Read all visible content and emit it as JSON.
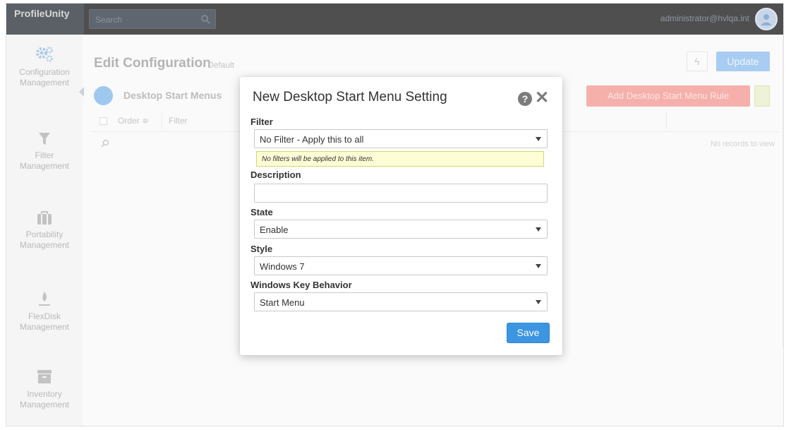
{
  "app": {
    "brand": "ProfileUnity",
    "search_placeholder": "Search",
    "user": "administrator@hvlqa.int"
  },
  "sidebar": {
    "items": [
      {
        "label_line1": "Configuration",
        "label_line2": "Management",
        "icon": "gears-icon"
      },
      {
        "label_line1": "Filter",
        "label_line2": "Management",
        "icon": "funnel-icon"
      },
      {
        "label_line1": "Portability",
        "label_line2": "Management",
        "icon": "briefcase-icon"
      },
      {
        "label_line1": "FlexDisk",
        "label_line2": "Management",
        "icon": "flame-icon"
      },
      {
        "label_line1": "Inventory",
        "label_line2": "Management",
        "icon": "archive-box-icon"
      }
    ]
  },
  "main": {
    "title": "Edit Configuration",
    "subtitle": "Default",
    "update_label": "Update",
    "section_title": "Desktop Start Menus",
    "add_rule_label": "Add Desktop Start Menu Rule",
    "columns": [
      "Order",
      "Filter"
    ],
    "no_records": "No records to view"
  },
  "modal": {
    "title": "New Desktop Start Menu Setting",
    "filter_label": "Filter",
    "filter_value": "No Filter - Apply this to all",
    "filter_note": "No filters will be applied to this item.",
    "description_label": "Description",
    "description_value": "",
    "state_label": "State",
    "state_value": "Enable",
    "style_label": "Style",
    "style_value": "Windows 7",
    "winkey_label": "Windows Key Behavior",
    "winkey_value": "Start Menu",
    "save_label": "Save"
  },
  "colors": {
    "topbar": "#4f4f4f",
    "accent": "#3b95e0",
    "add_rule": "#f5b0ab",
    "note_bg": "#fdfdd6"
  }
}
